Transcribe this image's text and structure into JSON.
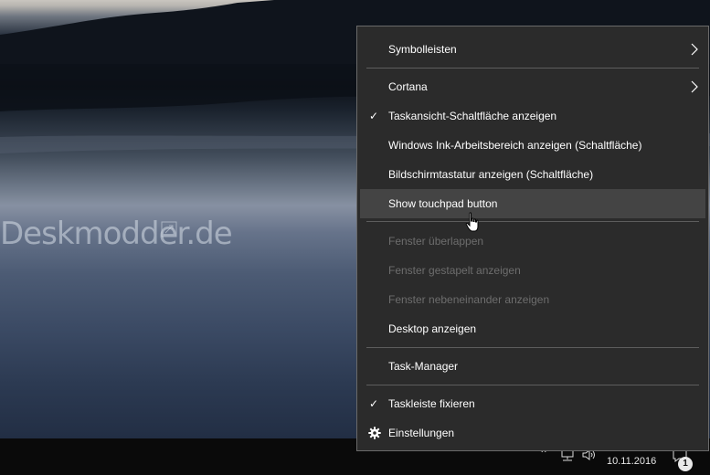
{
  "watermark": {
    "text": "Deskmodder.de"
  },
  "menu": {
    "symbolleisten": "Symbolleisten",
    "cortana": "Cortana",
    "taskview": "Taskansicht-Schaltfläche anzeigen",
    "ink": "Windows Ink-Arbeitsbereich anzeigen (Schaltfläche)",
    "keyboard": "Bildschirmtastatur anzeigen (Schaltfläche)",
    "touchpad": "Show touchpad button",
    "cascade": "Fenster überlappen",
    "stacked": "Fenster gestapelt anzeigen",
    "side_by_side": "Fenster nebeneinander anzeigen",
    "desktop": "Desktop anzeigen",
    "taskmanager": "Task-Manager",
    "lock": "Taskleiste fixieren",
    "settings": "Einstellungen"
  },
  "tray": {
    "date": "10.11.2016",
    "notification_count": "1"
  },
  "icons": {
    "submenu": "chevron-right-icon",
    "check": "checkmark-icon",
    "settings": "gear-icon",
    "cursor": "hand-pointer-icon"
  }
}
